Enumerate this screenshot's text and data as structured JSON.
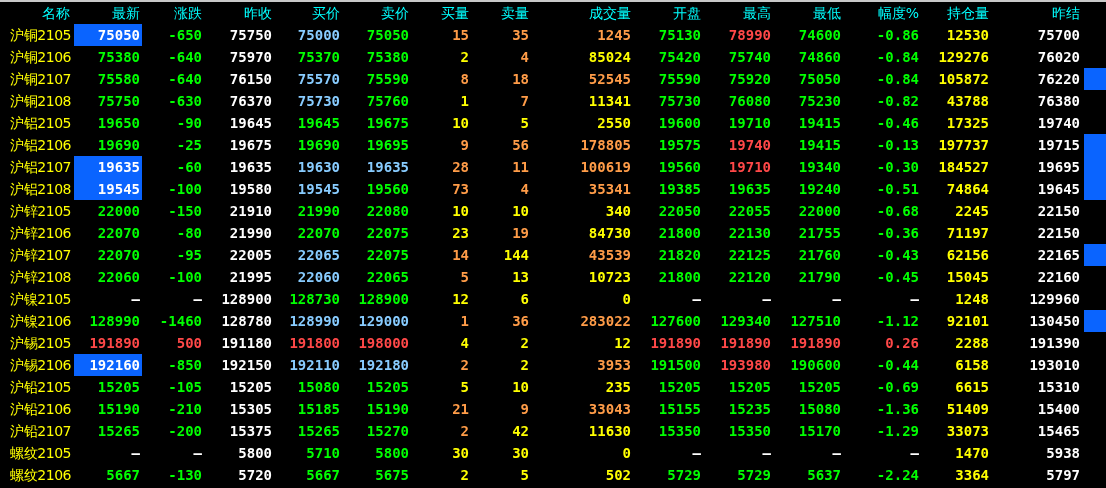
{
  "columns": [
    "名称",
    "最新",
    "涨跌",
    "昨收",
    "买价",
    "卖价",
    "买量",
    "卖量",
    "成交量",
    "开盘",
    "最高",
    "最低",
    "幅度%",
    "持仓量",
    "昨结"
  ],
  "rows": [
    {
      "name": "沪铜2105",
      "highlight": true,
      "marked": false,
      "cells": [
        {
          "text": "75050"
        },
        {
          "text": "-650",
          "color": "#00ff00"
        },
        {
          "text": "75750",
          "color": "#ffffff"
        },
        {
          "text": "75000",
          "color": "#88ccff"
        },
        {
          "text": "75050",
          "color": "#00ff00"
        },
        {
          "text": "15",
          "color": "#ff9c48"
        },
        {
          "text": "35",
          "color": "#ff9c48"
        },
        {
          "text": "1245",
          "color": "#ff9c48"
        },
        {
          "text": "75130",
          "color": "#00ff00"
        },
        {
          "text": "78990",
          "color": "#ff4848"
        },
        {
          "text": "74600",
          "color": "#00ff00"
        },
        {
          "text": "-0.86",
          "color": "#00ff00"
        },
        {
          "text": "12530",
          "color": "#ffff00"
        },
        {
          "text": "75700",
          "color": "#ffffff"
        }
      ]
    },
    {
      "name": "沪铜2106",
      "highlight": false,
      "marked": false,
      "cells": [
        {
          "text": "75380",
          "color": "#00ff00"
        },
        {
          "text": "-640",
          "color": "#00ff00"
        },
        {
          "text": "75970",
          "color": "#ffffff"
        },
        {
          "text": "75370",
          "color": "#00ff00"
        },
        {
          "text": "75380",
          "color": "#00ff00"
        },
        {
          "text": "2",
          "color": "#ffff00"
        },
        {
          "text": "4",
          "color": "#ff9c48"
        },
        {
          "text": "85024",
          "color": "#ffff00"
        },
        {
          "text": "75420",
          "color": "#00ff00"
        },
        {
          "text": "75740",
          "color": "#00ff00"
        },
        {
          "text": "74860",
          "color": "#00ff00"
        },
        {
          "text": "-0.84",
          "color": "#00ff00"
        },
        {
          "text": "129276",
          "color": "#ffff00"
        },
        {
          "text": "76020",
          "color": "#ffffff"
        }
      ]
    },
    {
      "name": "沪铜2107",
      "highlight": false,
      "marked": true,
      "cells": [
        {
          "text": "75580",
          "color": "#00ff00"
        },
        {
          "text": "-640",
          "color": "#00ff00"
        },
        {
          "text": "76150",
          "color": "#ffffff"
        },
        {
          "text": "75570",
          "color": "#88ccff"
        },
        {
          "text": "75590",
          "color": "#00ff00"
        },
        {
          "text": "8",
          "color": "#ff9c48"
        },
        {
          "text": "18",
          "color": "#ff9c48"
        },
        {
          "text": "52545",
          "color": "#ff9c48"
        },
        {
          "text": "75590",
          "color": "#00ff00"
        },
        {
          "text": "75920",
          "color": "#00ff00"
        },
        {
          "text": "75050",
          "color": "#00ff00"
        },
        {
          "text": "-0.84",
          "color": "#00ff00"
        },
        {
          "text": "105872",
          "color": "#ffff00"
        },
        {
          "text": "76220",
          "color": "#ffffff"
        }
      ]
    },
    {
      "name": "沪铜2108",
      "highlight": false,
      "marked": false,
      "cells": [
        {
          "text": "75750",
          "color": "#00ff00"
        },
        {
          "text": "-630",
          "color": "#00ff00"
        },
        {
          "text": "76370",
          "color": "#ffffff"
        },
        {
          "text": "75730",
          "color": "#88ccff"
        },
        {
          "text": "75760",
          "color": "#00ff00"
        },
        {
          "text": "1",
          "color": "#ffff00"
        },
        {
          "text": "7",
          "color": "#ff9c48"
        },
        {
          "text": "11341",
          "color": "#ffff00"
        },
        {
          "text": "75730",
          "color": "#00ff00"
        },
        {
          "text": "76080",
          "color": "#00ff00"
        },
        {
          "text": "75230",
          "color": "#00ff00"
        },
        {
          "text": "-0.82",
          "color": "#00ff00"
        },
        {
          "text": "43788",
          "color": "#ffff00"
        },
        {
          "text": "76380",
          "color": "#ffffff"
        }
      ]
    },
    {
      "name": "沪铝2105",
      "highlight": false,
      "marked": false,
      "cells": [
        {
          "text": "19650",
          "color": "#00ff00"
        },
        {
          "text": "-90",
          "color": "#00ff00"
        },
        {
          "text": "19645",
          "color": "#ffffff"
        },
        {
          "text": "19645",
          "color": "#00ff00"
        },
        {
          "text": "19675",
          "color": "#00ff00"
        },
        {
          "text": "10",
          "color": "#ffff00"
        },
        {
          "text": "5",
          "color": "#ffff00"
        },
        {
          "text": "2550",
          "color": "#ffff00"
        },
        {
          "text": "19600",
          "color": "#00ff00"
        },
        {
          "text": "19710",
          "color": "#00ff00"
        },
        {
          "text": "19415",
          "color": "#00ff00"
        },
        {
          "text": "-0.46",
          "color": "#00ff00"
        },
        {
          "text": "17325",
          "color": "#ffff00"
        },
        {
          "text": "19740",
          "color": "#ffffff"
        }
      ]
    },
    {
      "name": "沪铝2106",
      "highlight": false,
      "marked": true,
      "cells": [
        {
          "text": "19690",
          "color": "#00ff00"
        },
        {
          "text": "-25",
          "color": "#00ff00"
        },
        {
          "text": "19675",
          "color": "#ffffff"
        },
        {
          "text": "19690",
          "color": "#00ff00"
        },
        {
          "text": "19695",
          "color": "#00ff00"
        },
        {
          "text": "9",
          "color": "#ff9c48"
        },
        {
          "text": "56",
          "color": "#ff9c48"
        },
        {
          "text": "178805",
          "color": "#ff9c48"
        },
        {
          "text": "19575",
          "color": "#00ff00"
        },
        {
          "text": "19740",
          "color": "#ff4848"
        },
        {
          "text": "19415",
          "color": "#00ff00"
        },
        {
          "text": "-0.13",
          "color": "#00ff00"
        },
        {
          "text": "197737",
          "color": "#ffff00"
        },
        {
          "text": "19715",
          "color": "#ffffff"
        }
      ]
    },
    {
      "name": "沪铝2107",
      "highlight": true,
      "marked": true,
      "cells": [
        {
          "text": "19635"
        },
        {
          "text": "-60",
          "color": "#00ff00"
        },
        {
          "text": "19635",
          "color": "#ffffff"
        },
        {
          "text": "19630",
          "color": "#88ccff"
        },
        {
          "text": "19635",
          "color": "#88ccff"
        },
        {
          "text": "28",
          "color": "#ff9c48"
        },
        {
          "text": "11",
          "color": "#ff9c48"
        },
        {
          "text": "100619",
          "color": "#ff9c48"
        },
        {
          "text": "19560",
          "color": "#00ff00"
        },
        {
          "text": "19710",
          "color": "#ff4848"
        },
        {
          "text": "19340",
          "color": "#00ff00"
        },
        {
          "text": "-0.30",
          "color": "#00ff00"
        },
        {
          "text": "184527",
          "color": "#ffff00"
        },
        {
          "text": "19695",
          "color": "#ffffff"
        }
      ]
    },
    {
      "name": "沪铝2108",
      "highlight": true,
      "marked": true,
      "cells": [
        {
          "text": "19545"
        },
        {
          "text": "-100",
          "color": "#00ff00"
        },
        {
          "text": "19580",
          "color": "#ffffff"
        },
        {
          "text": "19545",
          "color": "#88ccff"
        },
        {
          "text": "19560",
          "color": "#00ff00"
        },
        {
          "text": "73",
          "color": "#ff9c48"
        },
        {
          "text": "4",
          "color": "#ff9c48"
        },
        {
          "text": "35341",
          "color": "#ff9c48"
        },
        {
          "text": "19385",
          "color": "#00ff00"
        },
        {
          "text": "19635",
          "color": "#00ff00"
        },
        {
          "text": "19240",
          "color": "#00ff00"
        },
        {
          "text": "-0.51",
          "color": "#00ff00"
        },
        {
          "text": "74864",
          "color": "#ffff00"
        },
        {
          "text": "19645",
          "color": "#ffffff"
        }
      ]
    },
    {
      "name": "沪锌2105",
      "highlight": false,
      "marked": false,
      "cells": [
        {
          "text": "22000",
          "color": "#00ff00"
        },
        {
          "text": "-150",
          "color": "#00ff00"
        },
        {
          "text": "21910",
          "color": "#ffffff"
        },
        {
          "text": "21990",
          "color": "#00ff00"
        },
        {
          "text": "22080",
          "color": "#00ff00"
        },
        {
          "text": "10",
          "color": "#ffff00"
        },
        {
          "text": "10",
          "color": "#ffff00"
        },
        {
          "text": "340",
          "color": "#ffff00"
        },
        {
          "text": "22050",
          "color": "#00ff00"
        },
        {
          "text": "22055",
          "color": "#00ff00"
        },
        {
          "text": "22000",
          "color": "#00ff00"
        },
        {
          "text": "-0.68",
          "color": "#00ff00"
        },
        {
          "text": "2245",
          "color": "#ffff00"
        },
        {
          "text": "22150",
          "color": "#ffffff"
        }
      ]
    },
    {
      "name": "沪锌2106",
      "highlight": false,
      "marked": false,
      "cells": [
        {
          "text": "22070",
          "color": "#00ff00"
        },
        {
          "text": "-80",
          "color": "#00ff00"
        },
        {
          "text": "21990",
          "color": "#ffffff"
        },
        {
          "text": "22070",
          "color": "#00ff00"
        },
        {
          "text": "22075",
          "color": "#00ff00"
        },
        {
          "text": "23",
          "color": "#ffff00"
        },
        {
          "text": "19",
          "color": "#ff9c48"
        },
        {
          "text": "84730",
          "color": "#ffff00"
        },
        {
          "text": "21800",
          "color": "#00ff00"
        },
        {
          "text": "22130",
          "color": "#00ff00"
        },
        {
          "text": "21755",
          "color": "#00ff00"
        },
        {
          "text": "-0.36",
          "color": "#00ff00"
        },
        {
          "text": "71197",
          "color": "#ffff00"
        },
        {
          "text": "22150",
          "color": "#ffffff"
        }
      ]
    },
    {
      "name": "沪锌2107",
      "highlight": false,
      "marked": true,
      "cells": [
        {
          "text": "22070",
          "color": "#00ff00"
        },
        {
          "text": "-95",
          "color": "#00ff00"
        },
        {
          "text": "22005",
          "color": "#ffffff"
        },
        {
          "text": "22065",
          "color": "#88ccff"
        },
        {
          "text": "22075",
          "color": "#00ff00"
        },
        {
          "text": "14",
          "color": "#ff9c48"
        },
        {
          "text": "144",
          "color": "#ffff00"
        },
        {
          "text": "43539",
          "color": "#ff9c48"
        },
        {
          "text": "21820",
          "color": "#00ff00"
        },
        {
          "text": "22125",
          "color": "#00ff00"
        },
        {
          "text": "21760",
          "color": "#00ff00"
        },
        {
          "text": "-0.43",
          "color": "#00ff00"
        },
        {
          "text": "62156",
          "color": "#ffff00"
        },
        {
          "text": "22165",
          "color": "#ffffff"
        }
      ]
    },
    {
      "name": "沪锌2108",
      "highlight": false,
      "marked": false,
      "cells": [
        {
          "text": "22060",
          "color": "#00ff00"
        },
        {
          "text": "-100",
          "color": "#00ff00"
        },
        {
          "text": "21995",
          "color": "#ffffff"
        },
        {
          "text": "22060",
          "color": "#88ccff"
        },
        {
          "text": "22065",
          "color": "#00ff00"
        },
        {
          "text": "5",
          "color": "#ff9c48"
        },
        {
          "text": "13",
          "color": "#ffff00"
        },
        {
          "text": "10723",
          "color": "#ffff00"
        },
        {
          "text": "21800",
          "color": "#00ff00"
        },
        {
          "text": "22120",
          "color": "#00ff00"
        },
        {
          "text": "21790",
          "color": "#00ff00"
        },
        {
          "text": "-0.45",
          "color": "#00ff00"
        },
        {
          "text": "15045",
          "color": "#ffff00"
        },
        {
          "text": "22160",
          "color": "#ffffff"
        }
      ]
    },
    {
      "name": "沪镍2105",
      "highlight": false,
      "marked": false,
      "cells": [
        {
          "text": "—",
          "color": "#ffffff"
        },
        {
          "text": "—",
          "color": "#ffffff"
        },
        {
          "text": "128900",
          "color": "#ffffff"
        },
        {
          "text": "128730",
          "color": "#00ff00"
        },
        {
          "text": "128900",
          "color": "#00ff00"
        },
        {
          "text": "12",
          "color": "#ffff00"
        },
        {
          "text": "6",
          "color": "#ffff00"
        },
        {
          "text": "0",
          "color": "#ffff00"
        },
        {
          "text": "—",
          "color": "#ffffff"
        },
        {
          "text": "—",
          "color": "#ffffff"
        },
        {
          "text": "—",
          "color": "#ffffff"
        },
        {
          "text": "—",
          "color": "#ffffff"
        },
        {
          "text": "1248",
          "color": "#ffff00"
        },
        {
          "text": "129960",
          "color": "#ffffff"
        }
      ]
    },
    {
      "name": "沪镍2106",
      "highlight": false,
      "marked": true,
      "cells": [
        {
          "text": "128990",
          "color": "#00ff00"
        },
        {
          "text": "-1460",
          "color": "#00ff00"
        },
        {
          "text": "128780",
          "color": "#ffffff"
        },
        {
          "text": "128990",
          "color": "#88ccff"
        },
        {
          "text": "129000",
          "color": "#88ccff"
        },
        {
          "text": "1",
          "color": "#ff9c48"
        },
        {
          "text": "36",
          "color": "#ff9c48"
        },
        {
          "text": "283022",
          "color": "#ff9c48"
        },
        {
          "text": "127600",
          "color": "#00ff00"
        },
        {
          "text": "129340",
          "color": "#00ff00"
        },
        {
          "text": "127510",
          "color": "#00ff00"
        },
        {
          "text": "-1.12",
          "color": "#00ff00"
        },
        {
          "text": "92101",
          "color": "#ffff00"
        },
        {
          "text": "130450",
          "color": "#ffffff"
        }
      ]
    },
    {
      "name": "沪锡2105",
      "highlight": false,
      "marked": false,
      "cells": [
        {
          "text": "191890",
          "color": "#ff4848"
        },
        {
          "text": "500",
          "color": "#ff4848"
        },
        {
          "text": "191180",
          "color": "#ffffff"
        },
        {
          "text": "191800",
          "color": "#ff4848"
        },
        {
          "text": "198000",
          "color": "#ff4848"
        },
        {
          "text": "4",
          "color": "#ffff00"
        },
        {
          "text": "2",
          "color": "#ffff00"
        },
        {
          "text": "12",
          "color": "#ffff00"
        },
        {
          "text": "191890",
          "color": "#ff4848"
        },
        {
          "text": "191890",
          "color": "#ff4848"
        },
        {
          "text": "191890",
          "color": "#ff4848"
        },
        {
          "text": "0.26",
          "color": "#ff4848"
        },
        {
          "text": "2288",
          "color": "#ffff00"
        },
        {
          "text": "191390",
          "color": "#ffffff"
        }
      ]
    },
    {
      "name": "沪锡2106",
      "highlight": true,
      "marked": false,
      "cells": [
        {
          "text": "192160"
        },
        {
          "text": "-850",
          "color": "#00ff00"
        },
        {
          "text": "192150",
          "color": "#ffffff"
        },
        {
          "text": "192110",
          "color": "#88ccff"
        },
        {
          "text": "192180",
          "color": "#88ccff"
        },
        {
          "text": "2",
          "color": "#ff9c48"
        },
        {
          "text": "2",
          "color": "#ffff00"
        },
        {
          "text": "3953",
          "color": "#ff9c48"
        },
        {
          "text": "191500",
          "color": "#00ff00"
        },
        {
          "text": "193980",
          "color": "#ff4848"
        },
        {
          "text": "190600",
          "color": "#00ff00"
        },
        {
          "text": "-0.44",
          "color": "#00ff00"
        },
        {
          "text": "6158",
          "color": "#ffff00"
        },
        {
          "text": "193010",
          "color": "#ffffff"
        }
      ]
    },
    {
      "name": "沪铅2105",
      "highlight": false,
      "marked": false,
      "cells": [
        {
          "text": "15205",
          "color": "#00ff00"
        },
        {
          "text": "-105",
          "color": "#00ff00"
        },
        {
          "text": "15205",
          "color": "#ffffff"
        },
        {
          "text": "15080",
          "color": "#00ff00"
        },
        {
          "text": "15205",
          "color": "#00ff00"
        },
        {
          "text": "5",
          "color": "#ffff00"
        },
        {
          "text": "10",
          "color": "#ffff00"
        },
        {
          "text": "235",
          "color": "#ffff00"
        },
        {
          "text": "15205",
          "color": "#00ff00"
        },
        {
          "text": "15205",
          "color": "#00ff00"
        },
        {
          "text": "15205",
          "color": "#00ff00"
        },
        {
          "text": "-0.69",
          "color": "#00ff00"
        },
        {
          "text": "6615",
          "color": "#ffff00"
        },
        {
          "text": "15310",
          "color": "#ffffff"
        }
      ]
    },
    {
      "name": "沪铅2106",
      "highlight": false,
      "marked": false,
      "cells": [
        {
          "text": "15190",
          "color": "#00ff00"
        },
        {
          "text": "-210",
          "color": "#00ff00"
        },
        {
          "text": "15305",
          "color": "#ffffff"
        },
        {
          "text": "15185",
          "color": "#00ff00"
        },
        {
          "text": "15190",
          "color": "#00ff00"
        },
        {
          "text": "21",
          "color": "#ff9c48"
        },
        {
          "text": "9",
          "color": "#ff9c48"
        },
        {
          "text": "33043",
          "color": "#ff9c48"
        },
        {
          "text": "15155",
          "color": "#00ff00"
        },
        {
          "text": "15235",
          "color": "#00ff00"
        },
        {
          "text": "15080",
          "color": "#00ff00"
        },
        {
          "text": "-1.36",
          "color": "#00ff00"
        },
        {
          "text": "51409",
          "color": "#ffff00"
        },
        {
          "text": "15400",
          "color": "#ffffff"
        }
      ]
    },
    {
      "name": "沪铅2107",
      "highlight": false,
      "marked": false,
      "cells": [
        {
          "text": "15265",
          "color": "#00ff00"
        },
        {
          "text": "-200",
          "color": "#00ff00"
        },
        {
          "text": "15375",
          "color": "#ffffff"
        },
        {
          "text": "15265",
          "color": "#00ff00"
        },
        {
          "text": "15270",
          "color": "#00ff00"
        },
        {
          "text": "2",
          "color": "#ff9c48"
        },
        {
          "text": "42",
          "color": "#ffff00"
        },
        {
          "text": "11630",
          "color": "#ffff00"
        },
        {
          "text": "15350",
          "color": "#00ff00"
        },
        {
          "text": "15350",
          "color": "#00ff00"
        },
        {
          "text": "15170",
          "color": "#00ff00"
        },
        {
          "text": "-1.29",
          "color": "#00ff00"
        },
        {
          "text": "33073",
          "color": "#ffff00"
        },
        {
          "text": "15465",
          "color": "#ffffff"
        }
      ]
    },
    {
      "name": "螺纹2105",
      "highlight": false,
      "marked": false,
      "cells": [
        {
          "text": "—",
          "color": "#ffffff"
        },
        {
          "text": "—",
          "color": "#ffffff"
        },
        {
          "text": "5800",
          "color": "#ffffff"
        },
        {
          "text": "5710",
          "color": "#00ff00"
        },
        {
          "text": "5800",
          "color": "#00ff00"
        },
        {
          "text": "30",
          "color": "#ffff00"
        },
        {
          "text": "30",
          "color": "#ffff00"
        },
        {
          "text": "0",
          "color": "#ffff00"
        },
        {
          "text": "—",
          "color": "#ffffff"
        },
        {
          "text": "—",
          "color": "#ffffff"
        },
        {
          "text": "—",
          "color": "#ffffff"
        },
        {
          "text": "—",
          "color": "#ffffff"
        },
        {
          "text": "1470",
          "color": "#ffff00"
        },
        {
          "text": "5938",
          "color": "#ffffff"
        }
      ]
    },
    {
      "name": "螺纹2106",
      "highlight": false,
      "marked": false,
      "cells": [
        {
          "text": "5667",
          "color": "#00ff00"
        },
        {
          "text": "-130",
          "color": "#00ff00"
        },
        {
          "text": "5720",
          "color": "#ffffff"
        },
        {
          "text": "5667",
          "color": "#00ff00"
        },
        {
          "text": "5675",
          "color": "#00ff00"
        },
        {
          "text": "2",
          "color": "#ffff00"
        },
        {
          "text": "5",
          "color": "#ffff00"
        },
        {
          "text": "502",
          "color": "#ffff00"
        },
        {
          "text": "5729",
          "color": "#00ff00"
        },
        {
          "text": "5729",
          "color": "#00ff00"
        },
        {
          "text": "5637",
          "color": "#00ff00"
        },
        {
          "text": "-2.24",
          "color": "#00ff00"
        },
        {
          "text": "3364",
          "color": "#ffff00"
        },
        {
          "text": "5797",
          "color": "#ffffff"
        }
      ]
    }
  ]
}
